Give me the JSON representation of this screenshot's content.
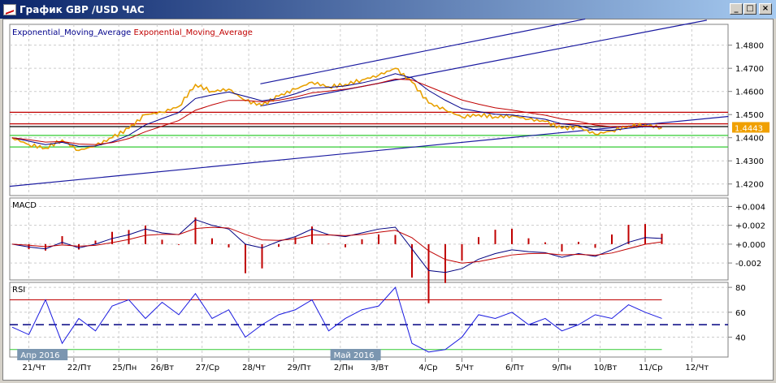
{
  "window": {
    "title": "График GBP /USD  ЧАС",
    "minimize": "_",
    "maximize": "□",
    "close": "×"
  },
  "legend": [
    {
      "label": "Exponential_Moving_Average",
      "color": "#00008b"
    },
    {
      "label": "Exponential_Moving_Average",
      "color": "#c00000"
    }
  ],
  "panels": {
    "macd": "MACD",
    "rsi": "RSI"
  },
  "current_price": "1.4443",
  "colors": {
    "price": "#e8a000",
    "ema_fast": "#00008b",
    "ema_slow": "#c00000",
    "grid": "#c8c8c8"
  },
  "chart_data": [
    {
      "type": "line",
      "title": "GBP/USD",
      "ylim": [
        1.415,
        1.489
      ],
      "yticks": [
        "1.4800",
        "1.4700",
        "1.4600",
        "1.4500",
        "1.4400",
        "1.4300",
        "1.4200"
      ],
      "price": [
        1.44,
        1.437,
        1.4355,
        1.439,
        1.4345,
        1.4365,
        1.44,
        1.444,
        1.45,
        1.451,
        1.4535,
        1.463,
        1.46,
        1.461,
        1.456,
        1.454,
        1.458,
        1.461,
        1.464,
        1.462,
        1.463,
        1.465,
        1.467,
        1.47,
        1.464,
        1.455,
        1.452,
        1.449,
        1.45,
        1.449,
        1.4495,
        1.448,
        1.447,
        1.444,
        1.4445,
        1.4415,
        1.443,
        1.445,
        1.4455,
        1.4443
      ],
      "hlines": [
        {
          "price": 1.451,
          "color": "#c00000"
        },
        {
          "price": 1.446,
          "color": "#c00000"
        },
        {
          "price": 1.4448,
          "color": "#000000"
        },
        {
          "price": 1.441,
          "color": "#33cc33"
        },
        {
          "price": 1.436,
          "color": "#33cc33"
        }
      ],
      "trendlines": [
        {
          "from": [
            14.9,
            1.4633
          ],
          "to": [
            34.4,
            1.4913
          ]
        },
        {
          "from": [
            14.9,
            1.4537
          ],
          "to": [
            41.7,
            1.4908
          ]
        },
        {
          "from": [
            -0.15,
            1.419
          ],
          "to": [
            43,
            1.4492
          ]
        }
      ]
    },
    {
      "type": "line",
      "title": "MACD",
      "ylim": [
        -0.0038,
        0.0049
      ],
      "yticks": [
        "+0.004",
        "+0.002",
        "+0.000",
        "-0.002"
      ],
      "macd": [
        0.0,
        -0.3,
        -0.5,
        0.2,
        -0.4,
        0.0,
        0.6,
        1.0,
        1.6,
        1.2,
        1.0,
        2.6,
        2.0,
        1.6,
        0.0,
        -0.4,
        0.3,
        0.8,
        1.6,
        1.0,
        0.8,
        1.2,
        1.6,
        1.8,
        -0.5,
        -2.8,
        -3.0,
        -2.6,
        -1.6,
        -1.0,
        -0.6,
        -0.8,
        -0.9,
        -1.4,
        -1.0,
        -1.3,
        -0.6,
        0.2,
        0.7,
        0.6
      ],
      "unit": 0.001
    },
    {
      "type": "line",
      "title": "RSI",
      "ylim": [
        24,
        84
      ],
      "yticks": [
        "80",
        "60",
        "40"
      ],
      "levels": [
        70,
        50,
        30
      ],
      "rsi": [
        48,
        42,
        70,
        35,
        55,
        45,
        65,
        70,
        55,
        68,
        58,
        75,
        55,
        62,
        40,
        50,
        58,
        62,
        70,
        45,
        55,
        62,
        65,
        80,
        35,
        28,
        30,
        40,
        58,
        55,
        60,
        50,
        55,
        45,
        50,
        58,
        55,
        66,
        60,
        55
      ]
    }
  ],
  "x_axis": {
    "months": [
      "Апр 2016",
      "Май 2016"
    ],
    "dates": [
      [
        "21",
        "Чт"
      ],
      [
        "22",
        "Пт"
      ],
      [
        "25",
        "Пн"
      ],
      [
        "26",
        "Вт"
      ],
      [
        "27",
        "Ср"
      ],
      [
        "28",
        "Чт"
      ],
      [
        "29",
        "Пт"
      ],
      [
        "2",
        "Пн"
      ],
      [
        "3",
        "Вт"
      ],
      [
        "4",
        "Ср"
      ],
      [
        "5",
        "Чт"
      ],
      [
        "6",
        "Пт"
      ],
      [
        "9",
        "Пн"
      ],
      [
        "10",
        "Вт"
      ],
      [
        "11",
        "Ср"
      ],
      [
        "12",
        "Чт"
      ]
    ],
    "date_idx": [
      1,
      3.7,
      6.4,
      8.7,
      11.4,
      14.2,
      16.9,
      19.7,
      21.9,
      24.8,
      27,
      30,
      32.8,
      35.3,
      38,
      40.8
    ]
  }
}
